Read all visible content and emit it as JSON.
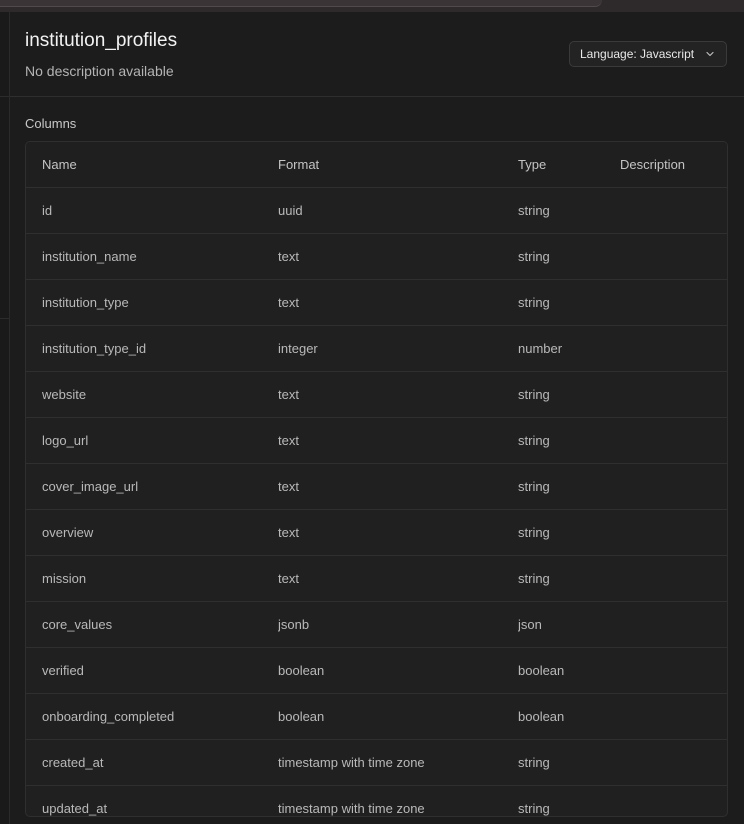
{
  "header": {
    "title": "institution_profiles",
    "description": "No description available",
    "language_label": "Language: Javascript"
  },
  "section": {
    "label": "Columns"
  },
  "table": {
    "headers": [
      "Name",
      "Format",
      "Type",
      "Description"
    ],
    "rows": [
      {
        "name": "id",
        "format": "uuid",
        "type": "string",
        "description": ""
      },
      {
        "name": "institution_name",
        "format": "text",
        "type": "string",
        "description": ""
      },
      {
        "name": "institution_type",
        "format": "text",
        "type": "string",
        "description": ""
      },
      {
        "name": "institution_type_id",
        "format": "integer",
        "type": "number",
        "description": ""
      },
      {
        "name": "website",
        "format": "text",
        "type": "string",
        "description": ""
      },
      {
        "name": "logo_url",
        "format": "text",
        "type": "string",
        "description": ""
      },
      {
        "name": "cover_image_url",
        "format": "text",
        "type": "string",
        "description": ""
      },
      {
        "name": "overview",
        "format": "text",
        "type": "string",
        "description": ""
      },
      {
        "name": "mission",
        "format": "text",
        "type": "string",
        "description": ""
      },
      {
        "name": "core_values",
        "format": "jsonb",
        "type": "json",
        "description": ""
      },
      {
        "name": "verified",
        "format": "boolean",
        "type": "boolean",
        "description": ""
      },
      {
        "name": "onboarding_completed",
        "format": "boolean",
        "type": "boolean",
        "description": ""
      },
      {
        "name": "created_at",
        "format": "timestamp with time zone",
        "type": "string",
        "description": ""
      },
      {
        "name": "updated_at",
        "format": "timestamp with time zone",
        "type": "string",
        "description": ""
      }
    ]
  },
  "icons": {
    "dropdown": "chevron-down-icon"
  }
}
